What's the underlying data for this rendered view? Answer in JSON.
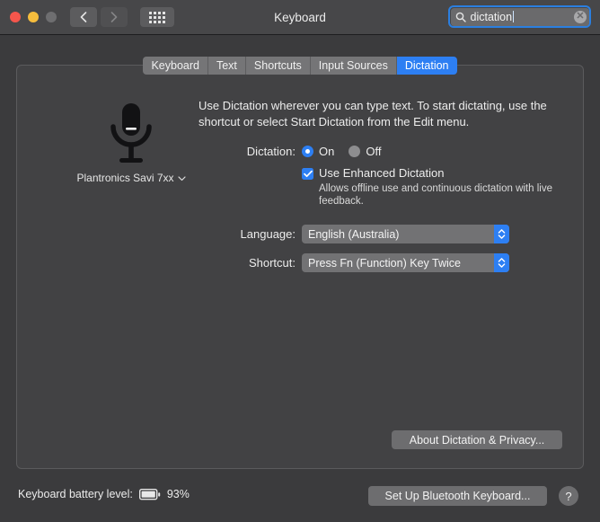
{
  "window": {
    "title": "Keyboard",
    "traffic_lights": [
      "close",
      "minimize",
      "zoom"
    ],
    "nav_back_icon": "chevron-left-icon",
    "nav_forward_icon": "chevron-right-icon",
    "grid_icon": "show-all-preferences-icon"
  },
  "search": {
    "icon": "search-icon",
    "value": "dictation",
    "placeholder": "Search",
    "clear_icon": "clear-icon",
    "clear_label": "✕"
  },
  "tabs": [
    {
      "label": "Keyboard",
      "active": false
    },
    {
      "label": "Text",
      "active": false
    },
    {
      "label": "Shortcuts",
      "active": false
    },
    {
      "label": "Input Sources",
      "active": false
    },
    {
      "label": "Dictation",
      "active": true
    }
  ],
  "mic": {
    "icon": "microphone-icon",
    "device_name": "Plantronics Savi 7xx",
    "chevron_icon": "chevron-down-icon"
  },
  "description": "Use Dictation wherever you can type text. To start dictating, use the shortcut or select Start Dictation from the Edit menu.",
  "dictation": {
    "label": "Dictation:",
    "on_label": "On",
    "off_label": "Off",
    "selected": "On"
  },
  "enhanced": {
    "label": "Use Enhanced Dictation",
    "checked": true,
    "check_glyph": "✓",
    "description": "Allows offline use and continuous dictation with live feedback."
  },
  "language": {
    "label": "Language:",
    "value": "English (Australia)",
    "stepper_icon": "stepper-updown-icon"
  },
  "shortcut": {
    "label": "Shortcut:",
    "value": "Press Fn (Function) Key Twice",
    "stepper_icon": "stepper-updown-icon"
  },
  "buttons": {
    "about": "About Dictation & Privacy...",
    "setup_bluetooth": "Set Up Bluetooth Keyboard...",
    "help": "?"
  },
  "footer": {
    "battery_label": "Keyboard battery level:",
    "battery_icon": "battery-icon",
    "battery_percent": "93%"
  },
  "colors": {
    "accent_blue": "#2d7ff3",
    "window_bg": "#3b3b3d",
    "titlebar_bg": "#474749",
    "panel_bg": "#424244",
    "traffic_red": "#f5564c",
    "traffic_yellow": "#f6bd3d",
    "traffic_gray": "#6e6e70"
  }
}
